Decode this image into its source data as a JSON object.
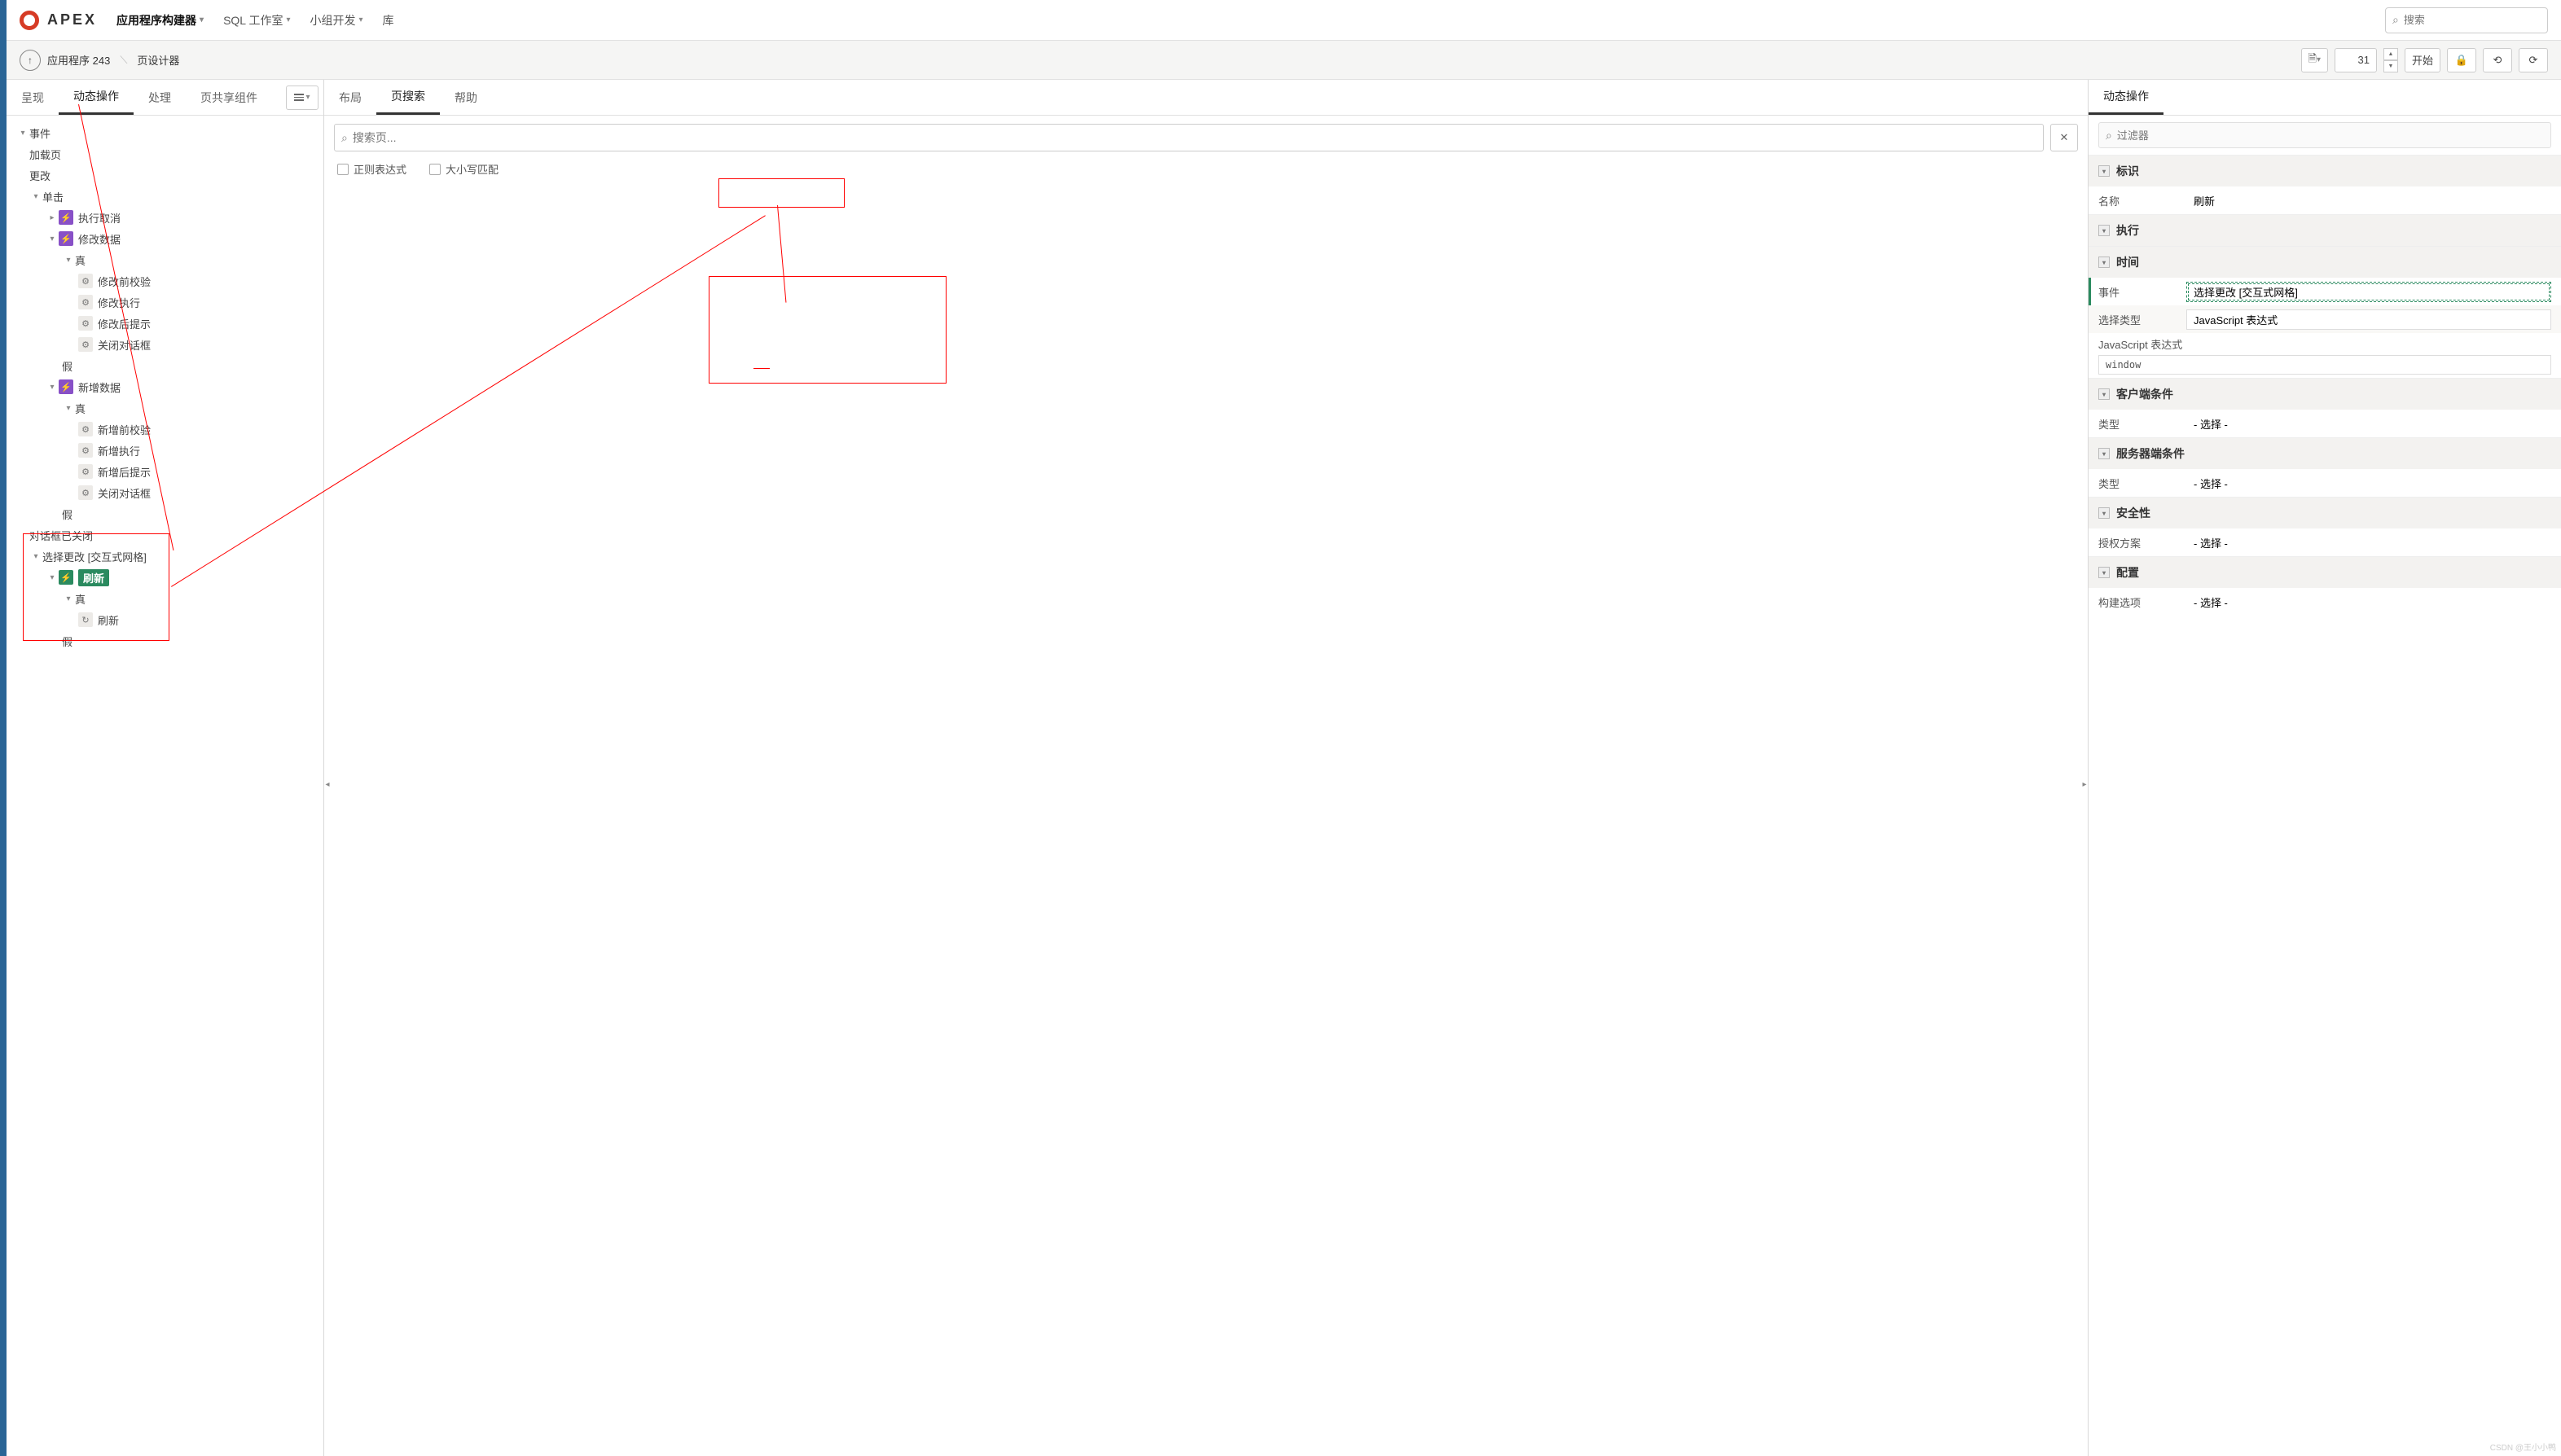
{
  "header": {
    "brand": "APEX",
    "nav": [
      {
        "label": "应用程序构建器",
        "active": true,
        "chev": true
      },
      {
        "label": "SQL 工作室",
        "chev": true
      },
      {
        "label": "小组开发",
        "chev": true
      },
      {
        "label": "库",
        "chev": false
      }
    ],
    "search_placeholder": "搜索"
  },
  "toolbar": {
    "crumb_app": "应用程序 243",
    "crumb_page": "页设计器",
    "page_number": "31",
    "start": "开始"
  },
  "left_panel": {
    "tabs": [
      "呈现",
      "动态操作",
      "处理",
      "页共享组件"
    ],
    "active_tab": "动态操作",
    "tree": {
      "events": "事件",
      "loadpage": "加载页",
      "change": "更改",
      "click": "单击",
      "exec_cancel": "执行取消",
      "mod_data": "修改数据",
      "true": "真",
      "false": "假",
      "mod_pre": "修改前校验",
      "mod_exec": "修改执行",
      "mod_post": "修改后提示",
      "close_dlg": "关闭对话框",
      "add_data": "新增数据",
      "add_pre": "新增前校验",
      "add_exec": "新增执行",
      "add_post": "新增后提示",
      "dlg_closed": "对话框已关闭",
      "sel_change": "选择更改 [交互式网格]",
      "refresh": "刷新",
      "refresh_action": "刷新"
    }
  },
  "mid_panel": {
    "tabs": [
      "布局",
      "页搜索",
      "帮助"
    ],
    "active_tab": "页搜索",
    "search_placeholder": "搜索页...",
    "chk_regex": "正则表达式",
    "chk_case": "大小写匹配"
  },
  "right_panel": {
    "title": "动态操作",
    "filter_placeholder": "过滤器",
    "groups": {
      "ident": "标识",
      "exec": "执行",
      "time": "时间",
      "client_cond": "客户端条件",
      "server_cond": "服务器端条件",
      "security": "安全性",
      "config": "配置"
    },
    "props": {
      "name_lbl": "名称",
      "name_val": "刷新",
      "event_lbl": "事件",
      "event_val": "选择更改 [交互式网格]",
      "seltype_lbl": "选择类型",
      "seltype_val": "JavaScript 表达式",
      "jsexpr_lbl": "JavaScript 表达式",
      "jsexpr_val": "window",
      "type_lbl": "类型",
      "type_val": "- 选择 -",
      "auth_lbl": "授权方案",
      "auth_val": "- 选择 -",
      "build_lbl": "构建选项",
      "build_val": "- 选择 -"
    }
  },
  "watermark": "CSDN @王小小鸭"
}
